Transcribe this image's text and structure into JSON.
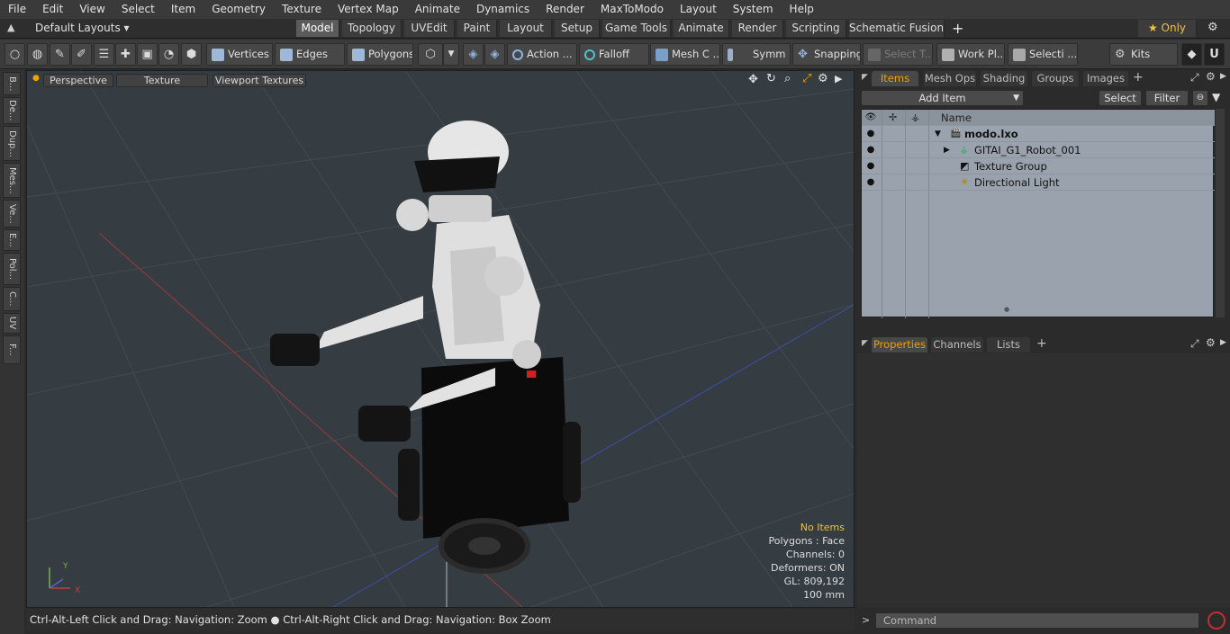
{
  "menu": [
    "File",
    "Edit",
    "View",
    "Select",
    "Item",
    "Geometry",
    "Texture",
    "Vertex Map",
    "Animate",
    "Dynamics",
    "Render",
    "MaxToModo",
    "Layout",
    "System",
    "Help"
  ],
  "layout_selector": "Default Layouts ▾",
  "layout_tabs": [
    {
      "label": "Model",
      "active": true
    },
    {
      "label": "Topology"
    },
    {
      "label": "UVEdit"
    },
    {
      "label": "Paint"
    },
    {
      "label": "Layout"
    },
    {
      "label": "Setup"
    },
    {
      "label": "Game Tools"
    },
    {
      "label": "Animate"
    },
    {
      "label": "Render"
    },
    {
      "label": "Scripting"
    },
    {
      "label": "Schematic Fusion"
    }
  ],
  "only_label": "★ Only",
  "toolbar": {
    "vertices": "Vertices",
    "edges": "Edges",
    "polygons": "Polygons",
    "action": "Action   ...",
    "falloff": "Falloff",
    "mesh": "Mesh C ...",
    "symm": "Symm ...",
    "snapping": "Snapping",
    "select_t": "Select T...",
    "work_plane": "Work Pl...",
    "selecti": "Selecti ...",
    "kits": "Kits"
  },
  "left_tabs": [
    "B...",
    "De...",
    "Dup...",
    "Mes...",
    "Ve...",
    "E...",
    "Pol...",
    "C...",
    "UV",
    "F..."
  ],
  "viewport": {
    "perspective": "Perspective",
    "texture": "Texture",
    "viewport_textures": "Viewport Textures",
    "hud": {
      "no_items": "No Items",
      "polygons": "Polygons : Face",
      "channels": "Channels: 0",
      "deformers": "Deformers: ON",
      "gl": "GL: 809,192",
      "unit": "100 mm"
    }
  },
  "statusbar": "Ctrl-Alt-Left Click and Drag: Navigation: Zoom ● Ctrl-Alt-Right Click and Drag: Navigation: Box Zoom",
  "items_panel": {
    "tabs": [
      "Items",
      "Mesh Ops",
      "Shading",
      "Groups",
      "Images"
    ],
    "add_item": "Add Item",
    "select": "Select",
    "filter": "Filter",
    "column_name": "Name",
    "rows": [
      {
        "label": "modo.lxo"
      },
      {
        "label": "GITAI_G1_Robot_001"
      },
      {
        "label": "Texture Group"
      },
      {
        "label": "Directional Light"
      }
    ]
  },
  "properties_panel": {
    "tabs": [
      "Properties",
      "Channels",
      "Lists"
    ]
  },
  "command_placeholder": "Command",
  "colors": {
    "accent": "#f0a000",
    "viewport_bg": "#353c42",
    "list_bg": "#9aa3ad"
  }
}
